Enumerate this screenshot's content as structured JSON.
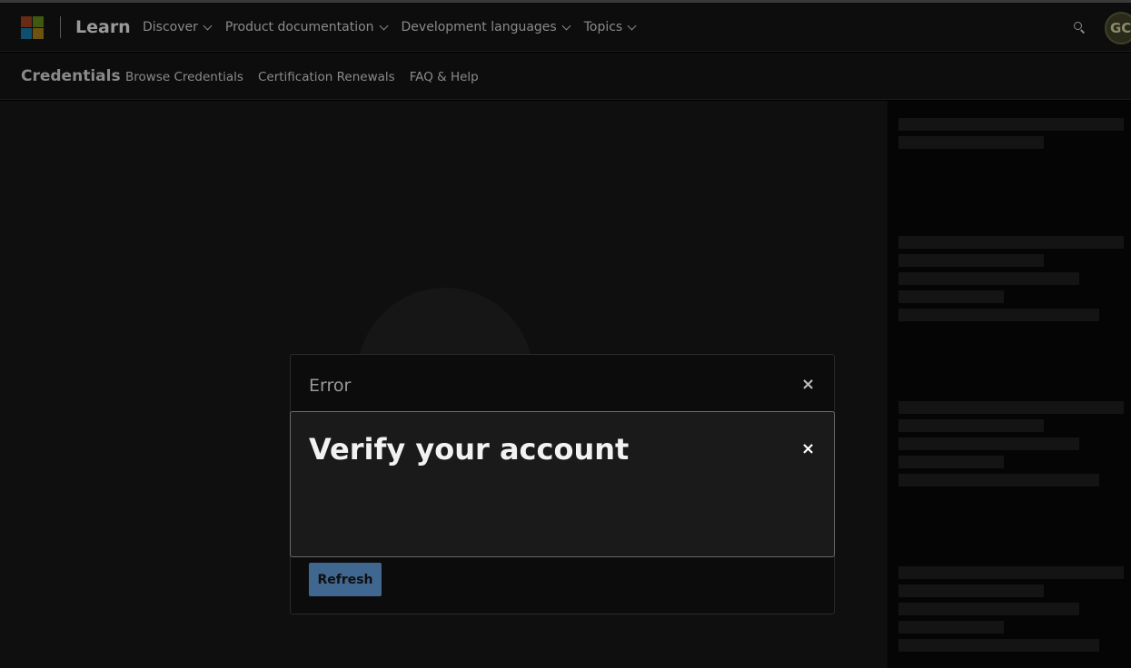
{
  "header": {
    "brand": "Learn",
    "nav": [
      {
        "label": "Discover"
      },
      {
        "label": "Product documentation"
      },
      {
        "label": "Development languages"
      },
      {
        "label": "Topics"
      }
    ],
    "avatar_initials": "GC",
    "logo_colors": [
      "#f25022",
      "#7fba00",
      "#00a4ef",
      "#ffb900"
    ]
  },
  "subheader": {
    "title": "Credentials",
    "links": [
      {
        "label": "Browse Credentials"
      },
      {
        "label": "Certification Renewals"
      },
      {
        "label": "FAQ & Help"
      }
    ]
  },
  "error_modal": {
    "title": "Error",
    "close_label": "×",
    "button_label": "Refresh"
  },
  "verify_dialog": {
    "title": "Verify your account",
    "close_label": "×"
  },
  "colors": {
    "accent": "#3f6790"
  }
}
